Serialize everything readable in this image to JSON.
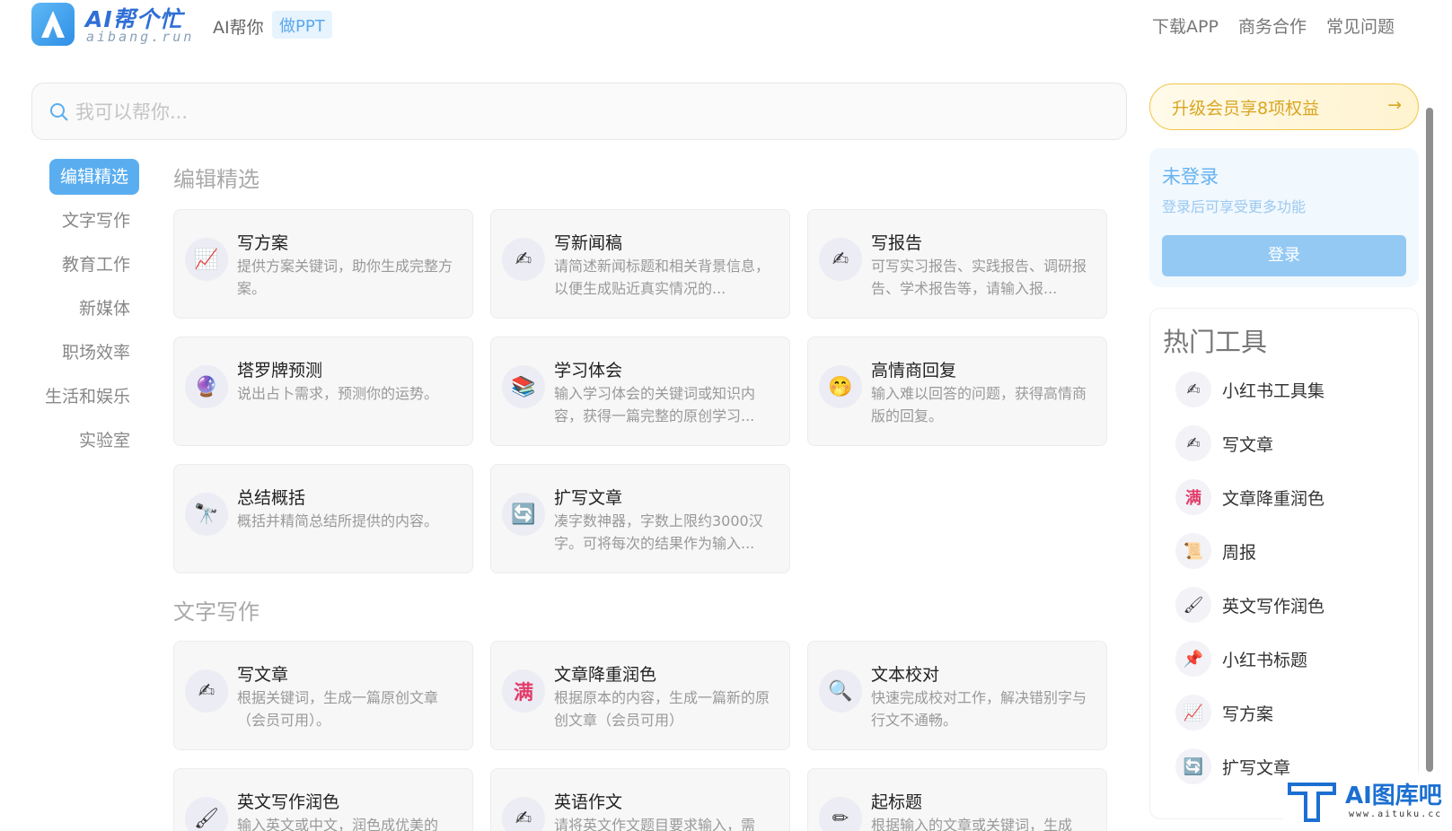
{
  "header": {
    "logo_title": "AI帮个忙",
    "logo_sub": "aibang.run",
    "brand": "AI帮你",
    "tag": "做PPT",
    "nav": [
      "下载APP",
      "商务合作",
      "常见问题"
    ]
  },
  "search": {
    "placeholder": "我可以帮你..."
  },
  "sidebar": {
    "items": [
      {
        "label": "编辑精选",
        "active": true
      },
      {
        "label": "文字写作"
      },
      {
        "label": "教育工作"
      },
      {
        "label": "新媒体"
      },
      {
        "label": "职场效率"
      },
      {
        "label": "生活和娱乐"
      },
      {
        "label": "实验室"
      }
    ]
  },
  "sections": [
    {
      "title": "编辑精选",
      "cards": [
        {
          "icon": "chart-icon",
          "glyph": "📈",
          "title": "写方案",
          "desc": "提供方案关键词，助你生成完整方案。"
        },
        {
          "icon": "pen-hand-icon",
          "glyph": "✍",
          "title": "写新闻稿",
          "desc": "请简述新闻标题和相关背景信息，以便生成贴近真实情况的..."
        },
        {
          "icon": "pen-hand-icon",
          "glyph": "✍",
          "title": "写报告",
          "desc": "可写实习报告、实践报告、调研报告、学术报告等，请输入报..."
        },
        {
          "icon": "crystal-ball-icon",
          "glyph": "🔮",
          "title": "塔罗牌预测",
          "desc": "说出占卜需求，预测你的运势。"
        },
        {
          "icon": "books-icon",
          "glyph": "📚",
          "title": "学习体会",
          "desc": "输入学习体会的关键词或知识内容，获得一篇完整的原创学习..."
        },
        {
          "icon": "smile-icon",
          "glyph": "🤭",
          "title": "高情商回复",
          "desc": "输入难以回答的问题，获得高情商版的回复。"
        },
        {
          "icon": "telescope-icon",
          "glyph": "🔭",
          "title": "总结概括",
          "desc": "概括并精简总结所提供的内容。"
        },
        {
          "icon": "refresh-icon",
          "glyph": "🔄",
          "title": "扩写文章",
          "desc": "凑字数神器，字数上限约3000汉字。可将每次的结果作为输入..."
        }
      ]
    },
    {
      "title": "文字写作",
      "cards": [
        {
          "icon": "pen-hand-icon",
          "glyph": "✍",
          "title": "写文章",
          "desc": "根据关键词，生成一篇原创文章（会员可用）。"
        },
        {
          "icon": "full-badge-icon",
          "glyph": "满",
          "title": "文章降重润色",
          "desc": "根据原本的内容，生成一篇新的原创文章（会员可用）"
        },
        {
          "icon": "magnifier-icon",
          "glyph": "🔍",
          "title": "文本校对",
          "desc": "快速完成校对工作，解决错别字与行文不通畅。"
        },
        {
          "icon": "brush-icon",
          "glyph": "🖌",
          "title": "英文写作润色",
          "desc": "输入英文或中文，润色成优美的"
        },
        {
          "icon": "pen-hand-icon",
          "glyph": "✍",
          "title": "英语作文",
          "desc": "请将英文作文题目要求输入，需"
        },
        {
          "icon": "pencil-icon",
          "glyph": "✏",
          "title": "起标题",
          "desc": "根据输入的文章或关键词，生成"
        }
      ]
    }
  ],
  "upgrade": {
    "label": "升级会员享8项权益",
    "arrow": "→"
  },
  "login": {
    "title": "未登录",
    "subtitle": "登录后可享受更多功能",
    "button": "登录"
  },
  "hot_tools": {
    "title": "热门工具",
    "items": [
      {
        "icon": "pen-hand-icon",
        "glyph": "✍",
        "label": "小红书工具集"
      },
      {
        "icon": "pen-hand-icon",
        "glyph": "✍",
        "label": "写文章"
      },
      {
        "icon": "full-badge-icon",
        "glyph": "满",
        "label": "文章降重润色"
      },
      {
        "icon": "scroll-icon",
        "glyph": "📜",
        "label": "周报"
      },
      {
        "icon": "brush-icon",
        "glyph": "🖌",
        "label": "英文写作润色"
      },
      {
        "icon": "pushpin-icon",
        "glyph": "📌",
        "label": "小红书标题"
      },
      {
        "icon": "chart-icon",
        "glyph": "📈",
        "label": "写方案"
      },
      {
        "icon": "refresh-icon",
        "glyph": "🔄",
        "label": "扩写文章"
      }
    ]
  },
  "watermark": {
    "main": "AI图库吧",
    "sub": "www.aituku.cc"
  }
}
